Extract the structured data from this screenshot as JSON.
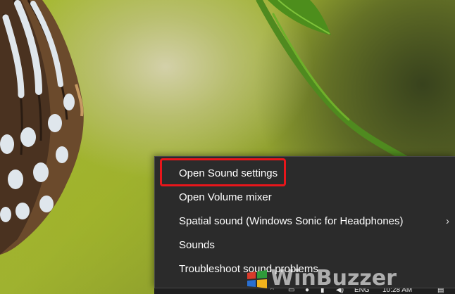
{
  "context_menu": {
    "items": [
      {
        "label": "Open Sound settings",
        "highlighted": true
      },
      {
        "label": "Open Volume mixer"
      },
      {
        "label": "Spatial sound (Windows Sonic for Headphones)",
        "submenu": true,
        "chevron": "›"
      },
      {
        "label": "Sounds"
      },
      {
        "label": "Troubleshoot sound problems"
      }
    ],
    "highlight_color": "#e8161b"
  },
  "taskbar": {
    "language": "ENG",
    "clock": "10:28 AM",
    "icons": [
      "volume-icon",
      "network-icon",
      "notification-icon"
    ]
  },
  "watermark": {
    "text": "WinBuzzer"
  },
  "wallpaper": {
    "description_icon": "butterfly-wing-and-leaf"
  }
}
